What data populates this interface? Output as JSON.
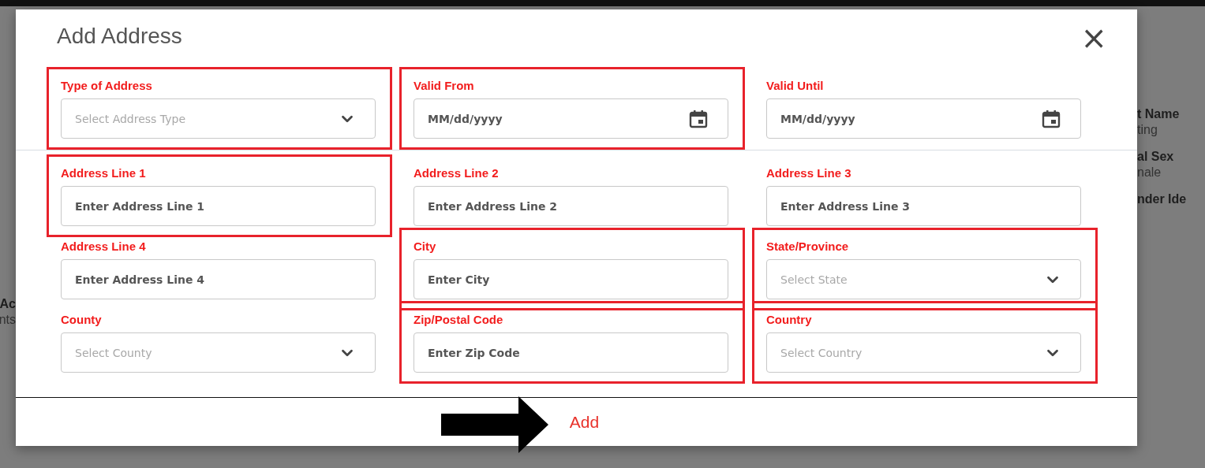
{
  "background": {
    "left_texts": [
      "Ac",
      "nts"
    ],
    "right_texts": [
      {
        "text": "t Name",
        "kind": "label"
      },
      {
        "text": "ting",
        "kind": "value"
      },
      {
        "text": "al Sex",
        "kind": "label"
      },
      {
        "text": "nale",
        "kind": "value"
      },
      {
        "text": "nder Ide",
        "kind": "label"
      }
    ]
  },
  "dialog": {
    "title": "Add Address",
    "close": "×",
    "fields": [
      {
        "label": "Type of Address",
        "kind": "select",
        "placeholder": "Select Address Type",
        "annotated": true
      },
      {
        "label": "Valid From",
        "kind": "date",
        "placeholder": "MM/dd/yyyy",
        "annotated": true
      },
      {
        "label": "Valid Until",
        "kind": "date",
        "placeholder": "MM/dd/yyyy",
        "annotated": false
      },
      {
        "label": "Address Line 1",
        "kind": "text",
        "placeholder": "Enter Address Line 1",
        "annotated": true
      },
      {
        "label": "Address Line 2",
        "kind": "text",
        "placeholder": "Enter Address Line 2",
        "annotated": false
      },
      {
        "label": "Address Line 3",
        "kind": "text",
        "placeholder": "Enter Address Line 3",
        "annotated": false
      },
      {
        "label": "Address Line 4",
        "kind": "text",
        "placeholder": "Enter Address Line 4",
        "annotated": false
      },
      {
        "label": "City",
        "kind": "text",
        "placeholder": "Enter City",
        "annotated": true
      },
      {
        "label": "State/Province",
        "kind": "select",
        "placeholder": "Select State",
        "annotated": true
      },
      {
        "label": "County",
        "kind": "select",
        "placeholder": "Select County",
        "annotated": false
      },
      {
        "label": "Zip/Postal Code",
        "kind": "text",
        "placeholder": "Enter Zip Code",
        "annotated": true
      },
      {
        "label": "Country",
        "kind": "select",
        "placeholder": "Select Country",
        "annotated": true
      }
    ],
    "add_button": "Add"
  }
}
